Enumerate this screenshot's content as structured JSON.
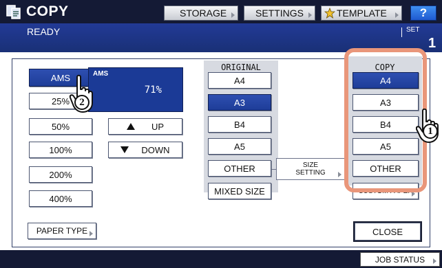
{
  "header": {
    "title": "COPY",
    "storage_label": "STORAGE",
    "settings_label": "SETTINGS",
    "template_label": "TEMPLATE",
    "help_label": "?"
  },
  "status": {
    "text": "READY",
    "set_label": "SET",
    "set_count": "1"
  },
  "zoom": {
    "ams_button": "AMS",
    "buttons": [
      "25%",
      "50%",
      "100%",
      "200%",
      "400%"
    ],
    "display_label": "AMS",
    "display_value": "71%",
    "up_label": "UP",
    "down_label": "DOWN"
  },
  "original": {
    "heading": "ORIGINAL",
    "sizes": [
      "A4",
      "A3",
      "B4",
      "A5",
      "OTHER"
    ],
    "selected": "A3",
    "mixed_label": "MIXED SIZE"
  },
  "size_setting": {
    "line1": "SIZE",
    "line2": "SETTING"
  },
  "copy": {
    "heading": "COPY",
    "sizes": [
      "A4",
      "A3",
      "B4",
      "A5",
      "OTHER"
    ],
    "selected": "A4",
    "custom_label": "CUSTOM PAPER"
  },
  "footer": {
    "paper_type_label": "PAPER TYPE",
    "close_label": "CLOSE",
    "job_status_label": "JOB STATUS"
  },
  "callouts": [
    "1",
    "2"
  ],
  "colors": {
    "title_bar": "#141a35",
    "status_bar": "#223a96",
    "selected_button": "#2e4fb1",
    "column_bg": "#d7dae1",
    "highlight": "#e9967a"
  }
}
